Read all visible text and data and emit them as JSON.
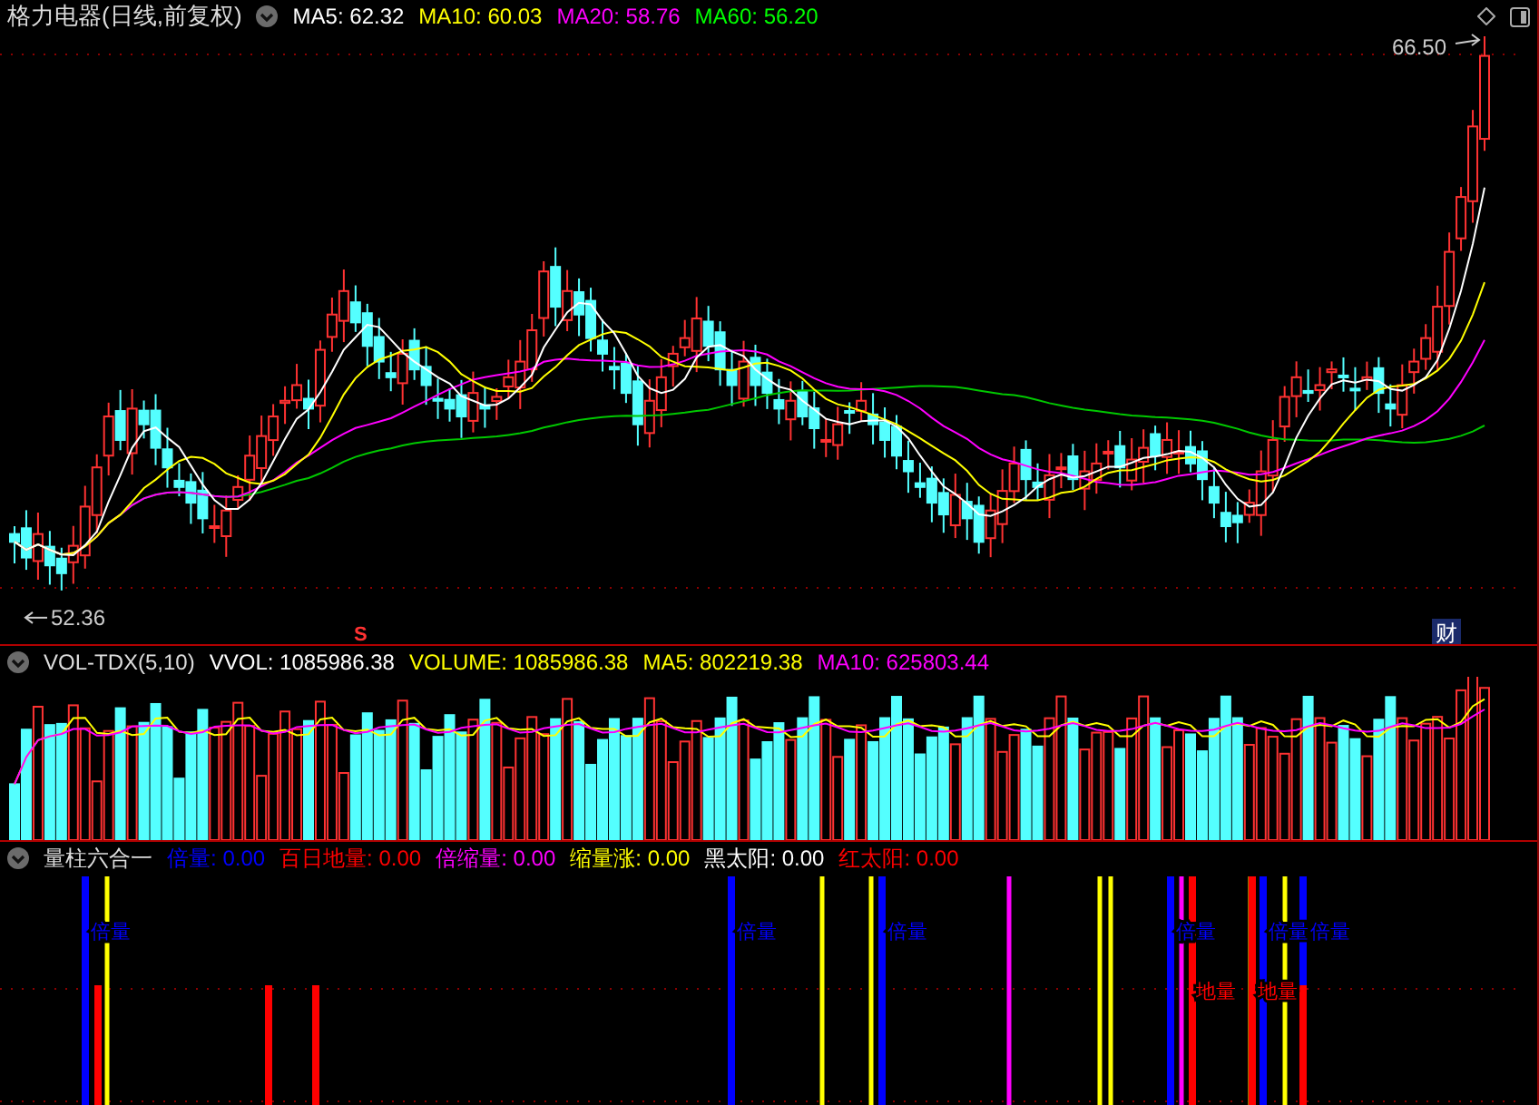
{
  "price_panel": {
    "title": "格力电器(日线,前复权)",
    "legend": [
      {
        "label": "MA5:",
        "value": "62.32",
        "color": "#ffffff"
      },
      {
        "label": "MA10:",
        "value": "60.03",
        "color": "#ffff00"
      },
      {
        "label": "MA20:",
        "value": "58.76",
        "color": "#ff00ff"
      },
      {
        "label": "MA60:",
        "value": "56.20",
        "color": "#00ff00"
      }
    ],
    "high_label": "66.50",
    "low_label": "52.36",
    "marker_s": "S",
    "marker_finance": "财"
  },
  "volume_panel": {
    "title": "VOL-TDX(5,10)",
    "legend": [
      {
        "label": "VVOL:",
        "value": "1085986.38",
        "color": "#ffffff"
      },
      {
        "label": "VOLUME:",
        "value": "1085986.38",
        "color": "#ffff00"
      },
      {
        "label": "MA5:",
        "value": "802219.38",
        "color": "#ffff00"
      },
      {
        "label": "MA10:",
        "value": "625803.44",
        "color": "#ff00ff"
      }
    ]
  },
  "signal_panel": {
    "title": "量柱六合一",
    "legend": [
      {
        "label": "倍量:",
        "value": "0.00",
        "color": "#0000ff"
      },
      {
        "label": "百日地量:",
        "value": "0.00",
        "color": "#ff0000"
      },
      {
        "label": "倍缩量:",
        "value": "0.00",
        "color": "#ff00ff"
      },
      {
        "label": "缩量涨:",
        "value": "0.00",
        "color": "#ffff00"
      },
      {
        "label": "黑太阳:",
        "value": "0.00",
        "color": "#ffffff"
      },
      {
        "label": "红太阳:",
        "value": "0.00",
        "color": "#ff0000"
      }
    ],
    "signal_labels": [
      {
        "kind": "double",
        "text": "倍量"
      },
      {
        "kind": "double",
        "text": "倍量"
      },
      {
        "kind": "double",
        "text": "倍量"
      },
      {
        "kind": "double",
        "text": "倍量"
      },
      {
        "kind": "double",
        "text": "倍量"
      },
      {
        "kind": "double",
        "text": "倍量"
      },
      {
        "kind": "bottom",
        "text": "地量"
      },
      {
        "kind": "bottom",
        "text": "地量"
      }
    ],
    "signals": [
      {
        "kind": "double",
        "tall": true
      },
      {
        "kind": "bottom",
        "tall": false
      },
      {
        "kind": "shrinkrise",
        "tall": true
      },
      {
        "kind": "bottom",
        "tall": false
      },
      {
        "kind": "bottom",
        "tall": false
      },
      {
        "kind": "double",
        "tall": true
      },
      {
        "kind": "shrinkrise",
        "tall": true
      },
      {
        "kind": "shrinkrise",
        "tall": true
      },
      {
        "kind": "double",
        "tall": true
      },
      {
        "kind": "doubleshrink",
        "tall": true
      },
      {
        "kind": "shrinkrise",
        "tall": true
      },
      {
        "kind": "shrinkrise",
        "tall": true
      },
      {
        "kind": "double",
        "tall": true
      },
      {
        "kind": "doubleshrink",
        "tall": true
      },
      {
        "kind": "bottom",
        "tall": true
      },
      {
        "kind": "shrinkrise",
        "tall": true
      },
      {
        "kind": "bottom",
        "tall": true
      },
      {
        "kind": "double",
        "tall": true
      },
      {
        "kind": "shrinkrise",
        "tall": true
      },
      {
        "kind": "double",
        "tall": true
      },
      {
        "kind": "bottom",
        "tall": false
      }
    ]
  }
}
